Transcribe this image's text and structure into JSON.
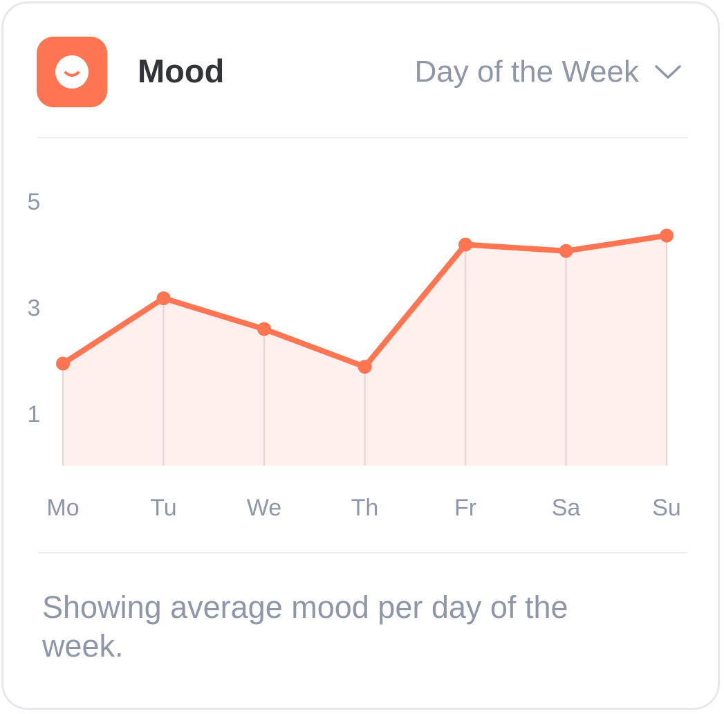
{
  "widget": {
    "title": "Mood",
    "icon": "smiley-face-icon",
    "dropdown": {
      "selected": "Day of the Week",
      "icon": "chevron-down-icon"
    },
    "footer": "Showing average mood per day of the week."
  },
  "colors": {
    "accent": "#ff7552",
    "fill": "#fff0ed",
    "gridline": "#e5d9d7",
    "text_muted": "#8e96a7",
    "title": "#333438"
  },
  "chart_data": {
    "type": "area",
    "categories": [
      "Mo",
      "Tu",
      "We",
      "Th",
      "Fr",
      "Sa",
      "Su"
    ],
    "values": [
      1.92,
      3.15,
      2.57,
      1.86,
      4.16,
      4.04,
      4.33
    ],
    "y_ticks": [
      "5",
      "3",
      "1"
    ],
    "ylim": [
      0,
      5
    ],
    "grid": false
  }
}
